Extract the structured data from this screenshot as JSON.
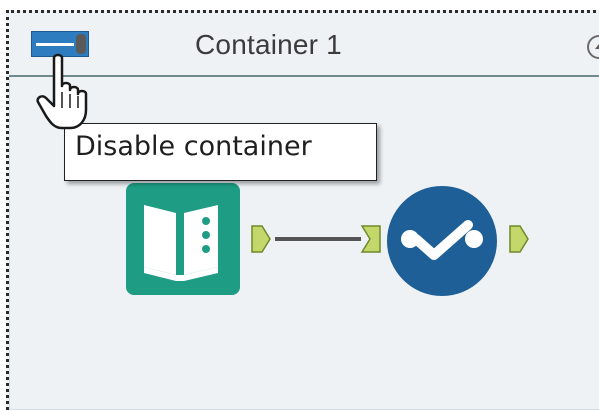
{
  "container": {
    "title": "Container 1",
    "toggle_state": "enabled"
  },
  "tooltip": {
    "text": "Disable container"
  },
  "colors": {
    "toggle_blue": "#2e7cc0",
    "book_tool_green": "#1e9c84",
    "check_tool_blue": "#1d5f96",
    "anchor_green": "#c3d76a"
  },
  "icons": {
    "toggle": "container-toggle-icon",
    "collapse": "collapse-up-icon",
    "cursor": "hand-pointer-icon",
    "input_tool": "book-input-tool-icon",
    "check_tool": "check-tool-icon"
  }
}
